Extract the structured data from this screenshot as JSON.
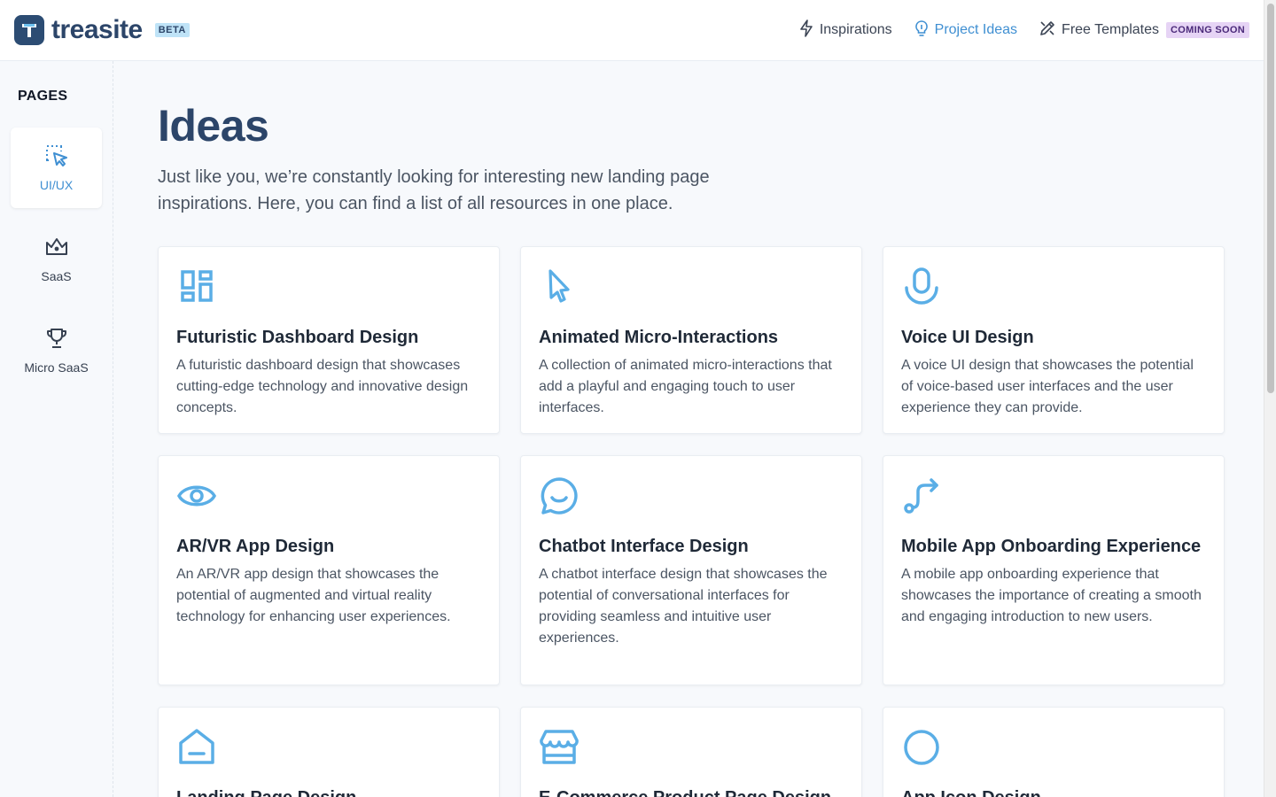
{
  "header": {
    "brand": "treasite",
    "badge": "BETA",
    "nav": [
      {
        "label": "Inspirations",
        "icon": "bolt-icon"
      },
      {
        "label": "Project Ideas",
        "icon": "bulb-icon",
        "active": true
      },
      {
        "label": "Free Templates",
        "icon": "pencil-ruler-icon",
        "badge": "COMING SOON"
      }
    ]
  },
  "sidebar": {
    "title": "PAGES",
    "items": [
      {
        "label": "UI/UX",
        "icon": "dotted-cursor-icon",
        "active": true
      },
      {
        "label": "SaaS",
        "icon": "crown-icon"
      },
      {
        "label": "Micro SaaS",
        "icon": "trophy-icon"
      }
    ]
  },
  "main": {
    "title": "Ideas",
    "intro": "Just like you, we’re constantly looking for interesting new landing page inspirations. Here, you can find a list of all resources in one place.",
    "cards": [
      {
        "title": "Futuristic Dashboard Design",
        "desc": "A futuristic dashboard design that showcases cutting-edge technology and innovative design concepts.",
        "icon": "dashboard-icon"
      },
      {
        "title": "Animated Micro-Interactions",
        "desc": "A collection of animated micro-interactions that add a playful and engaging touch to user interfaces.",
        "icon": "pointer-icon"
      },
      {
        "title": "Voice UI Design",
        "desc": "A voice UI design that showcases the potential of voice-based user interfaces and the user experience they can provide.",
        "icon": "microphone-icon"
      },
      {
        "title": "AR/VR App Design",
        "desc": "An AR/VR app design that showcases the potential of augmented and virtual reality technology for enhancing user experiences.",
        "icon": "eye-icon"
      },
      {
        "title": "Chatbot Interface Design",
        "desc": "A chatbot interface design that showcases the potential of conversational interfaces for providing seamless and intuitive user experiences.",
        "icon": "chat-smile-icon"
      },
      {
        "title": "Mobile App Onboarding Experience",
        "desc": "A mobile app onboarding experience that showcases the importance of creating a smooth and engaging introduction to new users.",
        "icon": "route-arrow-icon"
      },
      {
        "title": "Landing Page Design",
        "desc": "",
        "icon": "home-icon"
      },
      {
        "title": "E-Commerce Product Page Design",
        "desc": "",
        "icon": "storefront-icon"
      },
      {
        "title": "App Icon Design",
        "desc": "",
        "icon": "circle-icon"
      }
    ]
  }
}
